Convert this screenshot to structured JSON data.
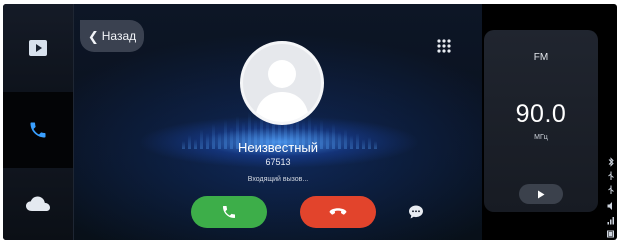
{
  "nav": {
    "back_label": "Назад",
    "items": [
      {
        "icon": "media-player-icon",
        "active": false
      },
      {
        "icon": "phone-icon",
        "active": true
      },
      {
        "icon": "cloud-icon",
        "active": false
      }
    ]
  },
  "call": {
    "caller_name": "Неизвестный",
    "caller_number": "67513",
    "status": "Входящий вызов..."
  },
  "radio": {
    "band": "FM",
    "frequency": "90.0",
    "unit": "МГц"
  },
  "colors": {
    "accent_blue": "#3aa0ff",
    "answer_green": "#3dae49",
    "decline_red": "#e2442c"
  }
}
